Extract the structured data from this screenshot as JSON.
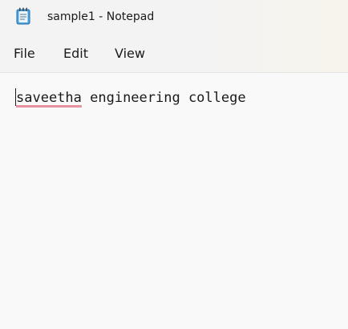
{
  "window": {
    "title": "sample1 - Notepad",
    "app_icon": "notepad-icon"
  },
  "menu": {
    "file": "File",
    "edit": "Edit",
    "view": "View"
  },
  "editor": {
    "misspelled_word": "saveetha",
    "rest_text": " engineering college",
    "spellcheck_underline_color": "#e88fa0"
  }
}
